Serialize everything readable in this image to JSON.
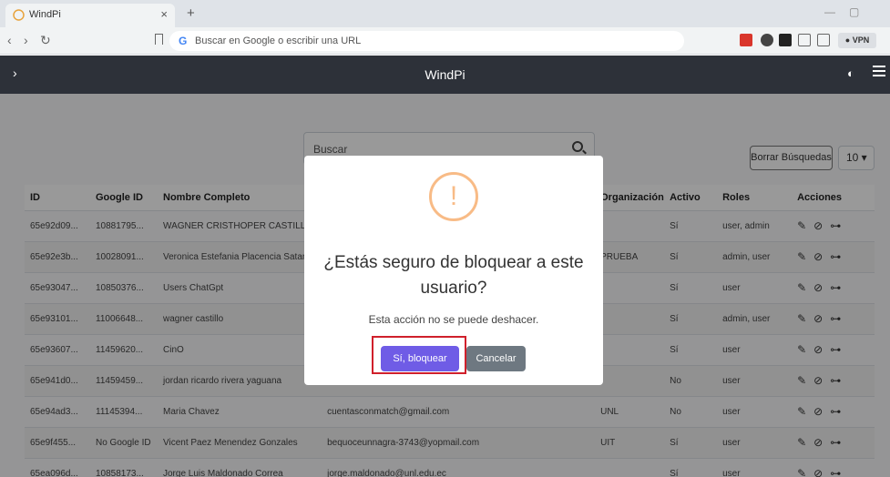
{
  "browser": {
    "tab_title": "WindPi",
    "tab_close": "×",
    "new_tab": "+",
    "url_placeholder": "Buscar en Google o escribir una URL",
    "google_icon": "G",
    "vpn_label": "● VPN",
    "min_icon": "—",
    "max_icon": "▢",
    "back_icon": "‹",
    "forward_icon": "›",
    "reload_icon": "↻"
  },
  "app": {
    "title": "WindPi",
    "sidebar_toggle": "›",
    "theme_icon": "◐"
  },
  "search": {
    "placeholder": "Buscar"
  },
  "controls": {
    "clear_label": "Borrar Búsquedas",
    "page_size": "10 ▾"
  },
  "table": {
    "headers": [
      "ID",
      "Google ID",
      "Nombre Completo",
      "",
      "Organización",
      "Activo",
      "Roles",
      "Acciones"
    ],
    "rows": [
      [
        "65e92d09...",
        "10881795...",
        "WAGNER CRISTHOPER CASTILLO C",
        "",
        "",
        "Sí",
        "user, admin"
      ],
      [
        "65e92e3b...",
        "10028091...",
        "Veronica Estefania Placencia Satama",
        "",
        "PRUEBA",
        "Sí",
        "admin, user"
      ],
      [
        "65e93047...",
        "10850376...",
        "Users ChatGpt",
        "",
        "",
        "Sí",
        "user"
      ],
      [
        "65e93101...",
        "11006648...",
        "wagner castillo",
        "",
        "",
        "Sí",
        "admin, user"
      ],
      [
        "65e93607...",
        "11459620...",
        "CinO",
        "",
        "",
        "Sí",
        "user"
      ],
      [
        "65e941d0...",
        "11459459...",
        "jordan ricardo rivera yaguana",
        "",
        "",
        "No",
        "user"
      ],
      [
        "65e94ad3...",
        "11145394...",
        "Maria Chavez",
        "cuentasconmatch@gmail.com",
        "UNL",
        "No",
        "user"
      ],
      [
        "65e9f455...",
        "No Google ID",
        "Vicent Paez Menendez Gonzales",
        "bequoceunnagra-3743@yopmail.com",
        "UIT",
        "Sí",
        "user"
      ],
      [
        "65ea096d...",
        "10858173...",
        "Jorge Luis Maldonado Correa",
        "jorge.maldonado@unl.edu.ec",
        "",
        "Sí",
        "user"
      ]
    ],
    "action_icons": {
      "edit": "✎",
      "block": "⊘",
      "key": "⊶"
    }
  },
  "modal": {
    "icon": "!",
    "title": "¿Estás seguro de bloquear a este usuario?",
    "text": "Esta acción no se puede deshacer.",
    "confirm_label": "Sí, bloquear",
    "cancel_label": "Cancelar"
  },
  "colors": {
    "header_bg": "#2d3139",
    "confirm_bg": "#6f5ce6",
    "cancel_bg": "#6e7881",
    "warning": "#f8bb86",
    "highlight_frame": "#d0202b"
  }
}
